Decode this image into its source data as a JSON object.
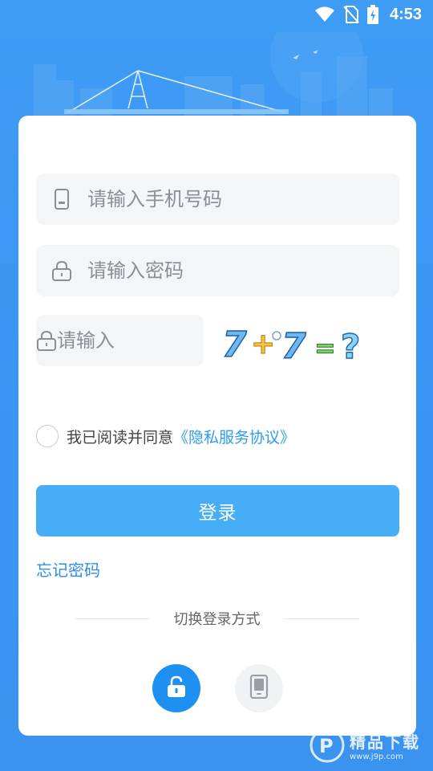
{
  "status_bar": {
    "time": "4:53",
    "icons": [
      "wifi-icon",
      "no-sim-icon",
      "battery-charging-icon"
    ]
  },
  "form": {
    "phone_placeholder": "请输入手机号码",
    "password_placeholder": "请输入密码",
    "captcha_placeholder": "请输入",
    "captcha_question": "7+7=?"
  },
  "agreement": {
    "text": "我已阅读并同意",
    "link": "《隐私服务协议》",
    "checked": false
  },
  "actions": {
    "login_label": "登录",
    "forgot_label": "忘记密码",
    "switch_label": "切换登录方式"
  },
  "login_modes": [
    {
      "icon": "lock-icon",
      "active": true
    },
    {
      "icon": "phone-icon",
      "active": false
    }
  ],
  "watermark": {
    "text": "精品下载",
    "url_text": "www.j9p.com"
  },
  "colors": {
    "background": "#3f9cf5",
    "primary_button": "#46aef7",
    "link": "#2e9bf0",
    "active_mode": "#1e90f2"
  }
}
